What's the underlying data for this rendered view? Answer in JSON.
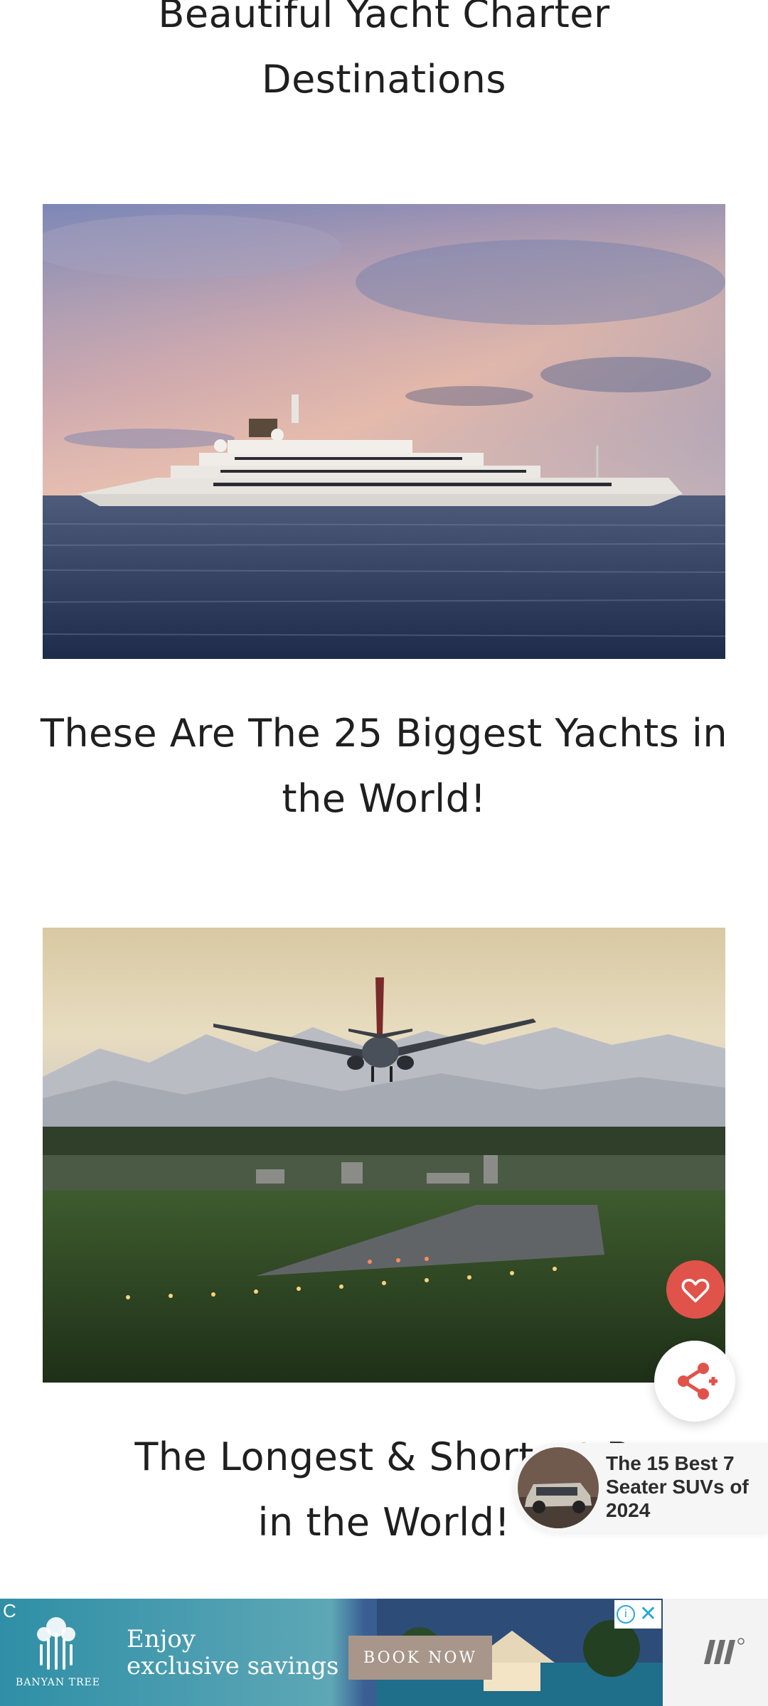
{
  "articles": [
    {
      "title_line1": "Beautiful Yacht Charter",
      "title_line2": "Destinations"
    },
    {
      "title_line1": "These Are The 25 Biggest Yachts in",
      "title_line2": "the World!",
      "image": "superyacht-at-sea-sunset"
    },
    {
      "title_line1": "The Longest & Shortest R",
      "title_line2": "in the World!",
      "image": "airplane-landing-runway-mountains"
    }
  ],
  "floating": {
    "favorite_icon": "heart-icon",
    "share_icon": "share-icon",
    "accent_color": "#e0534a"
  },
  "recommendation": {
    "title": "The 15 Best 7 Seater SUVs of 2024",
    "thumb": "suv-car-thumbnail"
  },
  "ad": {
    "brand": "BANYAN TREE",
    "headline_line1": "Enjoy",
    "headline_line2": "exclusive savings",
    "cta": "BOOK NOW",
    "close_symbol": "✕",
    "info_symbol": "i",
    "badge_letter": "C"
  }
}
